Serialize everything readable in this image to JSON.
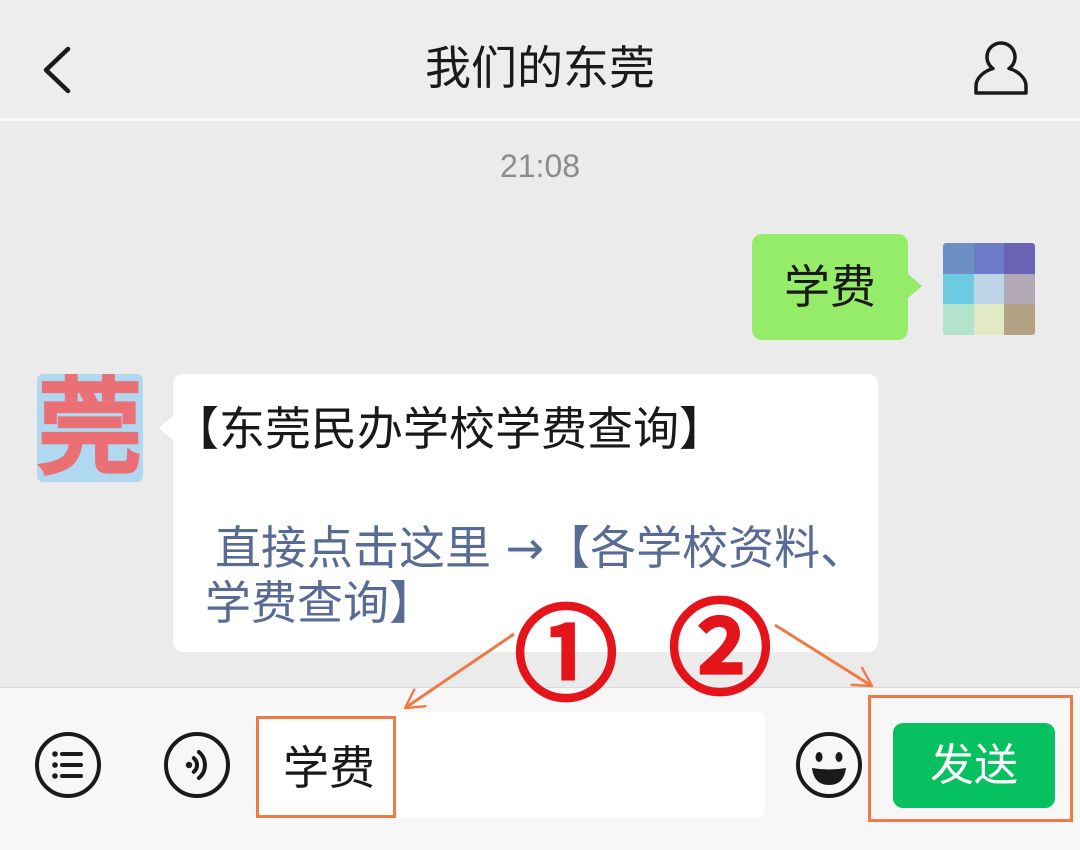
{
  "header": {
    "back_icon": "chevron-left-icon",
    "title": "我们的东莞",
    "profile_icon": "person-icon"
  },
  "chat": {
    "timestamp": "21:08",
    "messages": [
      {
        "text": "学费",
        "avatar_tiles": [
          "#6d8fc2",
          "#6c7bca",
          "#6a62b3",
          "#6dcbe1",
          "#bdd5e6",
          "#b3a8b5",
          "#b3e3cb",
          "#e2e9c5",
          "#b3a383"
        ]
      },
      {
        "avatar_glyph": "莞",
        "avatar_bg": "#b0d9f1",
        "avatar_glyph_color": "#ea7075",
        "title": "【东莞民办学校学费查询】",
        "link_lines": [
          "直接点击这里 →【各学校资料、",
          "学费查询】"
        ]
      }
    ]
  },
  "input_bar": {
    "menu_icon": "list-icon",
    "voice_icon": "voice-icon",
    "input_value": "学费",
    "emoji_icon": "emoji-icon",
    "send_label": "发送"
  },
  "annotations": {
    "step_1": "①",
    "step_2": "②",
    "marker_color": "#e5141b",
    "highlight_color": "#f07a45"
  },
  "colors": {
    "header_bg": "#ededed",
    "chat_bg": "#ebebeb",
    "self_bubble": "#95ec69",
    "other_bubble": "#ffffff",
    "link": "#576b95",
    "send_button": "#07c160",
    "input_bar_bg": "#f7f7f7"
  }
}
